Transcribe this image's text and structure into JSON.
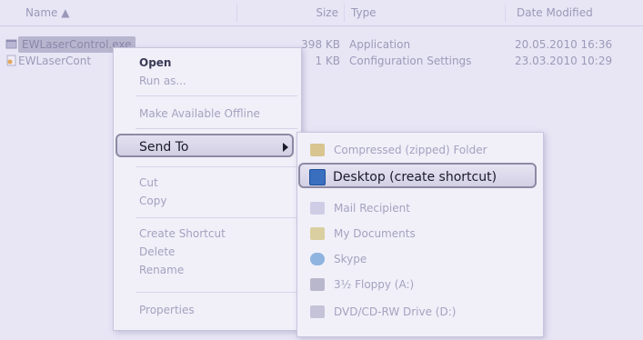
{
  "columns": {
    "name": "Name",
    "size": "Size",
    "type": "Type",
    "date": "Date Modified"
  },
  "files": [
    {
      "name": "EWLaserControl.exe",
      "size": "398 KB",
      "type": "Application",
      "date": "20.05.2010 16:36",
      "icon": "application-icon"
    },
    {
      "name": "EWLaserCont",
      "size": "1 KB",
      "type": "Configuration Settings",
      "date": "23.03.2010 10:29",
      "icon": "settings-file-icon"
    }
  ],
  "context_menu": {
    "open": "Open",
    "run_as": "Run as...",
    "make_offline": "Make Available Offline",
    "send_to": "Send To",
    "cut": "Cut",
    "copy": "Copy",
    "create_shortcut": "Create Shortcut",
    "delete": "Delete",
    "rename": "Rename",
    "properties": "Properties"
  },
  "send_to_menu": {
    "compressed": "Compressed (zipped) Folder",
    "desktop": "Desktop (create shortcut)",
    "mail": "Mail Recipient",
    "my_documents": "My Documents",
    "skype": "Skype",
    "floppy": "3½ Floppy (A:)",
    "dvd": "DVD/CD-RW Drive (D:)"
  },
  "colors": {
    "background": "#e8e6f5",
    "highlight_border": "#8c8aa3",
    "disabled_text": "#a4a2bf"
  }
}
